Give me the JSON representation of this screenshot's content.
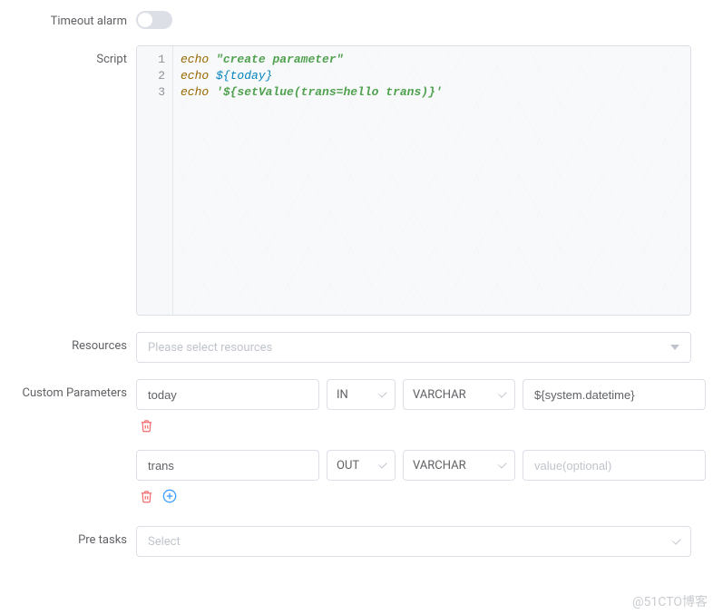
{
  "timeout": {
    "label": "Timeout alarm",
    "on": false
  },
  "script": {
    "label": "Script",
    "lines": [
      {
        "kw": "echo",
        "rest": "\"create parameter\"",
        "cls": "tok-str"
      },
      {
        "kw": "echo",
        "rest": "${today}",
        "cls": "tok-var"
      },
      {
        "kw": "echo",
        "rest": "'${setValue(trans=hello trans)}'",
        "cls": "tok-str"
      }
    ]
  },
  "resources": {
    "label": "Resources",
    "placeholder": "Please select resources"
  },
  "customParams": {
    "label": "Custom Parameters",
    "valuePlaceholder": "value(optional)",
    "rows": [
      {
        "name": "today",
        "direction": "IN",
        "type": "VARCHAR",
        "value": "${system.datetime}"
      },
      {
        "name": "trans",
        "direction": "OUT",
        "type": "VARCHAR",
        "value": ""
      }
    ]
  },
  "preTasks": {
    "label": "Pre tasks",
    "placeholder": "Select"
  },
  "watermark": "@51CTO博客"
}
